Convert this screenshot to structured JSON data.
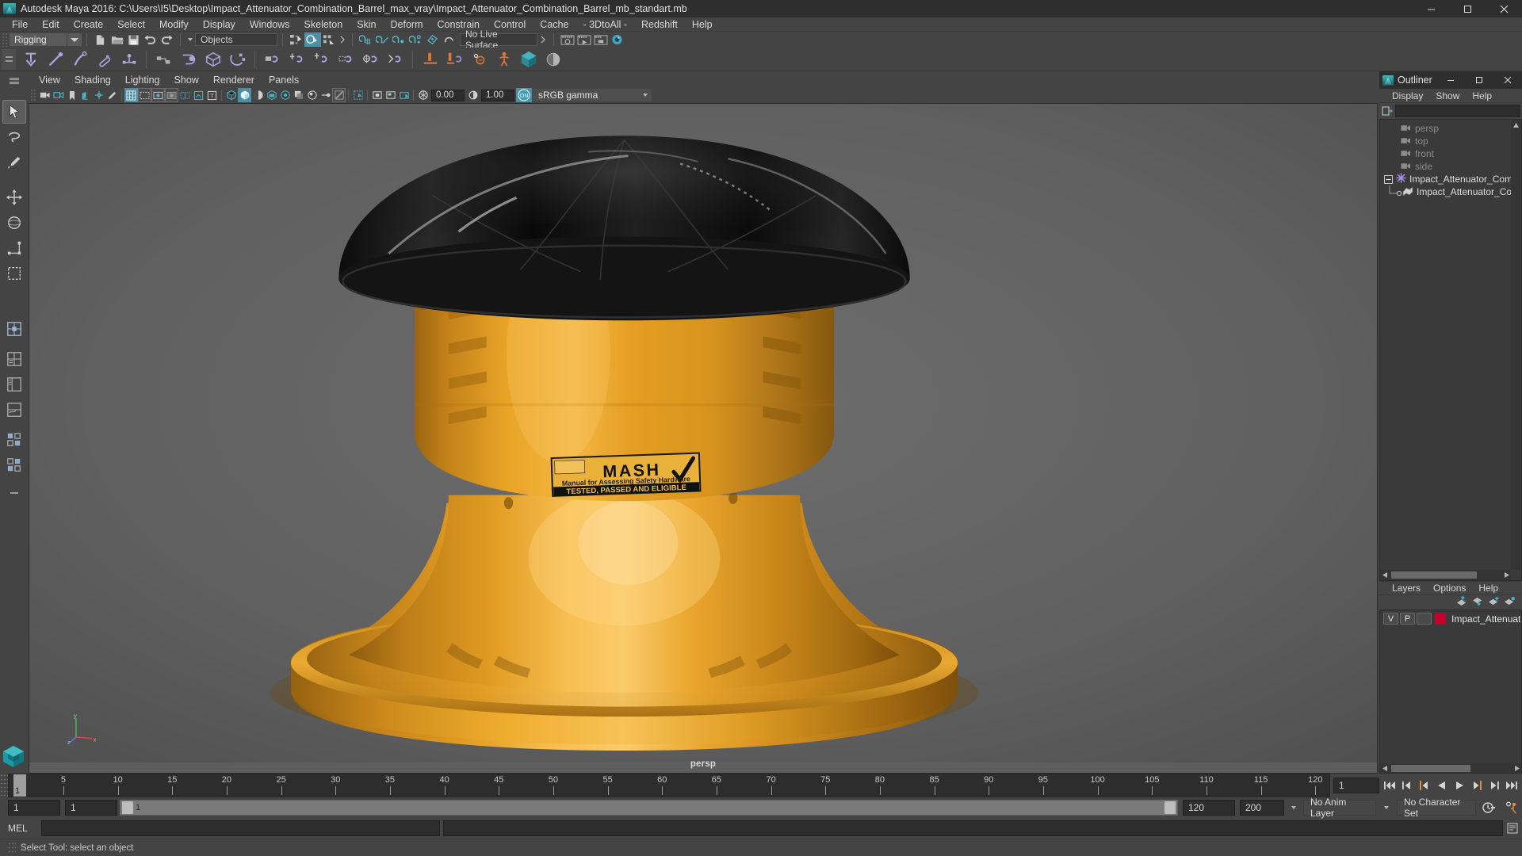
{
  "window": {
    "title": "Autodesk Maya 2016: C:\\Users\\I5\\Desktop\\Impact_Attenuator_Combination_Barrel_max_vray\\Impact_Attenuator_Combination_Barrel_mb_standart.mb",
    "logo_icon": "maya-logo-icon",
    "minimize": "–",
    "maximize": "☐",
    "close": "✕"
  },
  "menubar": {
    "items": [
      "File",
      "Edit",
      "Create",
      "Select",
      "Modify",
      "Display",
      "Windows",
      "Skeleton",
      "Skin",
      "Deform",
      "Constrain",
      "Control",
      "Cache",
      "- 3DtoAll -",
      "Redshift",
      "Help"
    ]
  },
  "statusline": {
    "menu_set": "Rigging",
    "selection_mask": "Objects",
    "live_surface": "No Live Surface",
    "icons": [
      "new-scene-icon",
      "open-scene-icon",
      "save-scene-icon",
      "undo-icon",
      "redo-icon",
      "select-hierarchy-icon",
      "select-object-icon",
      "select-component-icon",
      "snap-grid-icon",
      "snap-curve-icon",
      "snap-point-icon",
      "snap-projected-center-icon",
      "snap-view-plane-icon",
      "make-live-icon",
      "render-current-frame-icon",
      "ipr-render-icon",
      "render-settings-icon",
      "toggle-render-view-icon"
    ]
  },
  "shelf": {
    "tab_icon": "shelf-tab-icon",
    "buttons": [
      "create-joint-icon",
      "create-ik-handle-icon",
      "create-ik-spline-icon",
      "insert-joint-icon",
      "create-skeleton-icon",
      "mirror-joint-icon",
      "orient-joint-icon",
      "create-cluster-icon",
      "lattice-icon",
      "parent-constraint-icon",
      "point-constraint-icon",
      "aim-constraint-icon",
      "orient-constraint-icon",
      "scale-constraint-icon",
      "pole-vector-icon",
      "bind-skin-icon",
      "paint-weights-icon",
      "interactive-bind-icon",
      "mirror-weights-icon",
      "copy-weights-icon",
      "human-ik-icon",
      "quick-rig-icon",
      "redshift-icon"
    ]
  },
  "toolbox": {
    "tools": [
      "select-tool-icon",
      "lasso-select-tool-icon",
      "paint-select-tool-icon",
      "move-tool-icon",
      "rotate-tool-icon",
      "scale-tool-icon",
      "last-tool-icon",
      "show-manip-tool-icon",
      "single-view-layout-icon",
      "four-view-layout-icon",
      "persp-outliner-layout-icon",
      "persp-graph-layout-icon",
      "persp-hypershade-layout-icon",
      "more-layouts-icon"
    ],
    "maya_logo": "maya-logo-icon"
  },
  "viewport": {
    "menus": [
      "View",
      "Shading",
      "Lighting",
      "Show",
      "Renderer",
      "Panels"
    ],
    "camera_label": "persp",
    "exposure": "0.00",
    "gamma": "1.00",
    "color_management": "sRGB gamma",
    "color_mgmt_toggle": "ON",
    "icons": [
      "select-camera-icon",
      "camera-attributes-icon",
      "bookmarks-icon",
      "image-plane-icon",
      "two-d-pan-zoom-icon",
      "grease-pencil-icon",
      "grid-toggle-icon",
      "film-gate-icon",
      "resolution-gate-icon",
      "gate-mask-icon",
      "film-origin-icon",
      "xray-icon",
      "xray-joints-icon",
      "wireframe-icon",
      "smooth-shade-icon",
      "shaded-wireframe-icon",
      "textured-icon",
      "use-lights-icon",
      "shadows-icon",
      "ao-icon",
      "motion-blur-icon",
      "multisample-icon",
      "depth-peel-icon",
      "isolate-select-icon",
      "snapshot-icon"
    ],
    "axis_gizmo": {
      "y_label": "y",
      "x_label": "x",
      "z_label": "z",
      "y_color": "#4caf50",
      "x_color": "#e04040",
      "z_color": "#4f7fe0"
    },
    "model": {
      "name": "Impact Attenuator Combination Barrel",
      "body_color": "#e9a126",
      "lid_color": "#151515",
      "decal": {
        "title": "MASH",
        "subtitle": "Manual for Assessing Safety Hardware",
        "banner": "TESTED, PASSED AND ELIGIBLE",
        "check": "✔"
      }
    }
  },
  "outliner": {
    "title": "Outliner",
    "logo_icon": "maya-logo-icon",
    "minimize": "–",
    "maximize": "☐",
    "close": "✕",
    "menus": [
      "Display",
      "Show",
      "Help"
    ],
    "search_icon": "outliner-filter-icon",
    "search_value": "",
    "items": [
      {
        "label": "persp",
        "icon": "camera-icon",
        "dim": true,
        "indent": 0
      },
      {
        "label": "top",
        "icon": "camera-icon",
        "dim": true,
        "indent": 0
      },
      {
        "label": "front",
        "icon": "camera-icon",
        "dim": true,
        "indent": 0
      },
      {
        "label": "side",
        "icon": "camera-icon",
        "dim": true,
        "indent": 0
      },
      {
        "label": "Impact_Attenuator_Combina",
        "icon": "transform-icon",
        "dim": false,
        "indent": 0,
        "expanded": true
      },
      {
        "label": "Impact_Attenuator_Comb",
        "icon": "mesh-icon",
        "dim": false,
        "indent": 1
      }
    ]
  },
  "layers": {
    "menus": [
      "Layers",
      "Options",
      "Help"
    ],
    "tool_icons": [
      "move-layer-up-icon",
      "move-layer-down-icon",
      "new-layer-icon",
      "new-layer-from-selected-icon"
    ],
    "rows": [
      {
        "visibility": "V",
        "playback": "P",
        "shading": "",
        "color": "#c5002b",
        "name": "Impact_Attenuator_Co"
      }
    ]
  },
  "timeline": {
    "start_visible": 1,
    "ticks": [
      5,
      10,
      15,
      20,
      25,
      30,
      35,
      40,
      45,
      50,
      55,
      60,
      65,
      70,
      75,
      80,
      85,
      90,
      95,
      100,
      105,
      110,
      115,
      120
    ],
    "current_frame": "1",
    "current_frame_field": "1",
    "playback_buttons": [
      "go-to-start-icon",
      "step-back-keyframe-icon",
      "step-back-frame-icon",
      "play-backwards-icon",
      "play-forwards-icon",
      "step-forward-frame-icon",
      "step-forward-keyframe-icon",
      "go-to-end-icon"
    ]
  },
  "range": {
    "anim_start": "1",
    "range_start": "1",
    "slider_label": "1",
    "range_end": "120",
    "anim_end": "200",
    "anim_layer": "No Anim Layer",
    "character_set": "No Character Set",
    "auto_keyframe_icon": "auto-keyframe-icon",
    "anim_prefs_icon": "animation-preferences-icon"
  },
  "command_line": {
    "language": "MEL",
    "input_value": "",
    "output_value": "",
    "script_editor_icon": "script-editor-icon"
  },
  "status": {
    "help_text": "Select Tool: select an object"
  }
}
